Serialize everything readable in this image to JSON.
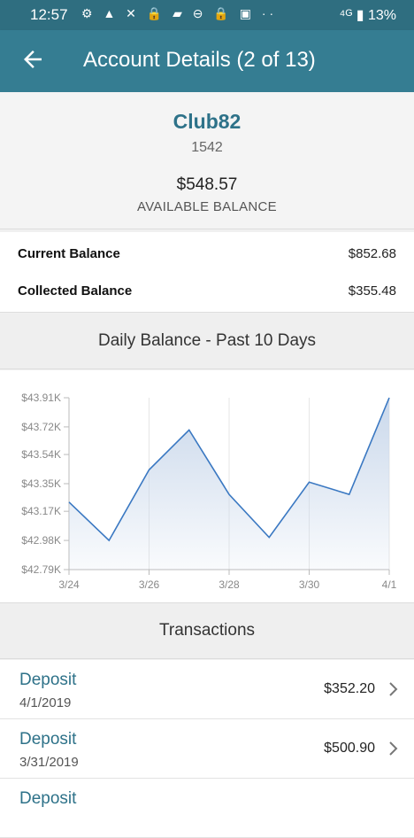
{
  "status_bar": {
    "time": "12:57",
    "icons_text": "⚙ ▲ ✕ 🔒 ▰ ⊖ 🔒 ▣ ··",
    "right_text": "⁴ᴳ ▮ 13%"
  },
  "header": {
    "title": "Account Details (2 of 13)"
  },
  "account": {
    "name": "Club82",
    "number": "1542",
    "available_amount": "$548.57",
    "available_label": "AVAILABLE BALANCE"
  },
  "balances": [
    {
      "label": "Current Balance",
      "value": "$852.68"
    },
    {
      "label": "Collected Balance",
      "value": "$355.48"
    }
  ],
  "chart_section_title": "Daily Balance - Past 10 Days",
  "chart_data": {
    "type": "area",
    "title": "Daily Balance - Past 10 Days",
    "xlabel": "",
    "ylabel": "",
    "x": [
      "3/24",
      "3/25",
      "3/26",
      "3/27",
      "3/28",
      "3/29",
      "3/30",
      "3/31",
      "4/1"
    ],
    "x_tick_labels": [
      "3/24",
      "3/26",
      "3/28",
      "3/30",
      "4/1"
    ],
    "y_tick_labels": [
      "$42.79K",
      "$42.98K",
      "$43.17K",
      "$43.35K",
      "$43.54K",
      "$43.72K",
      "$43.91K"
    ],
    "y_ticks": [
      42790,
      42980,
      43170,
      43350,
      43540,
      43720,
      43910
    ],
    "ylim": [
      42790,
      43910
    ],
    "series": [
      {
        "values": [
          43230,
          42980,
          43440,
          43700,
          43280,
          43000,
          43360,
          43280,
          43910
        ]
      }
    ],
    "color": "#3a78c2",
    "fill_color": "#c7d6ea"
  },
  "transactions_title": "Transactions",
  "transactions": [
    {
      "type": "Deposit",
      "date": "4/1/2019",
      "amount": "$352.20"
    },
    {
      "type": "Deposit",
      "date": "3/31/2019",
      "amount": "$500.90"
    },
    {
      "type": "Deposit",
      "date": "",
      "amount": ""
    }
  ]
}
